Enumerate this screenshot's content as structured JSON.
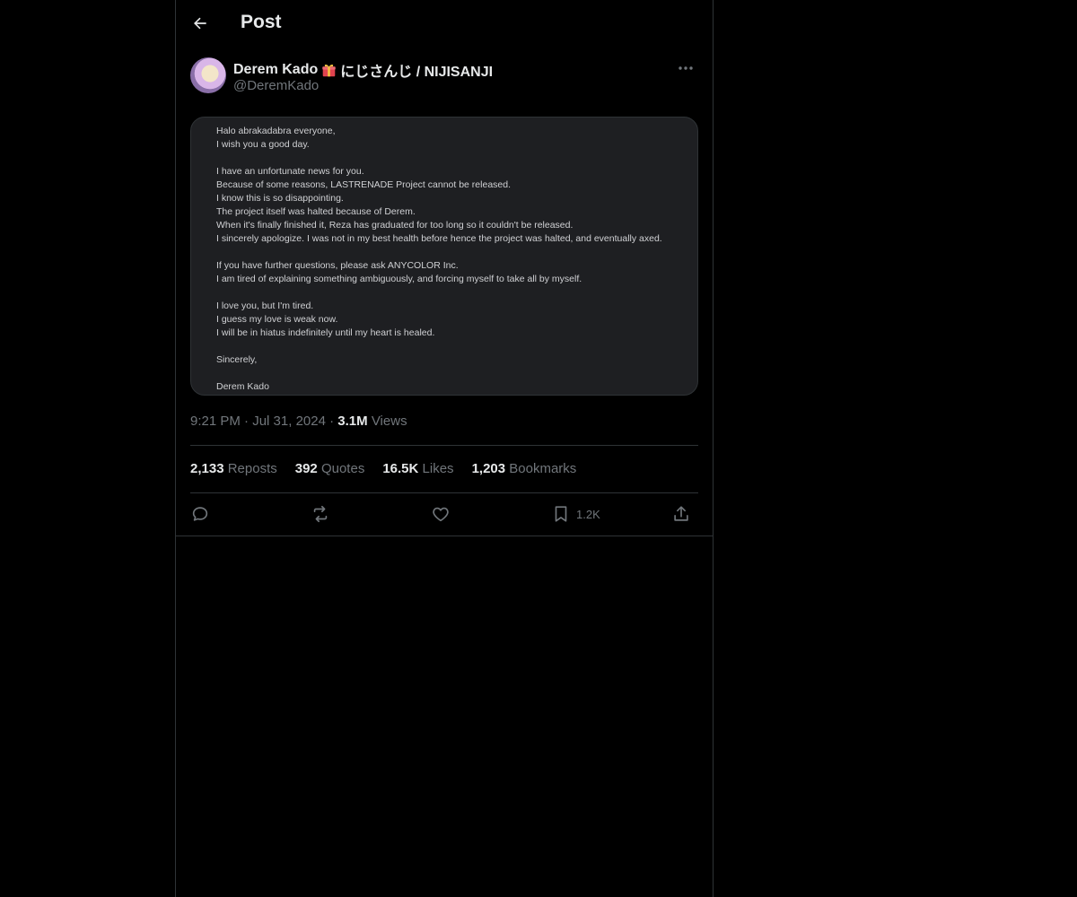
{
  "header": {
    "title": "Post"
  },
  "author": {
    "display_name": "Derem Kado",
    "display_name_suffix": "にじさんじ / NIJISANJI",
    "handle": "@DeremKado"
  },
  "media": {
    "lines": [
      "Halo abrakadabra everyone,",
      "I wish you a good day.",
      "",
      "I have an unfortunate news for you.",
      "Because of some reasons, LASTRENADE Project cannot be released.",
      "I know this is so disappointing.",
      "The project itself was halted because of Derem.",
      "When it's finally finished it, Reza has graduated for too long so it couldn't be released.",
      "I sincerely apologize. I was not in my best health before hence the project was halted, and eventually axed.",
      "",
      "If you have further questions, please ask ANYCOLOR Inc.",
      "I am tired of explaining something ambiguously, and forcing myself to take all by myself.",
      "",
      "I love you, but I'm tired.",
      "I guess my love is weak now.",
      "I will be in hiatus indefinitely until my heart is healed.",
      "",
      "Sincerely,",
      "",
      "Derem Kado"
    ]
  },
  "meta": {
    "time": "9:21 PM",
    "sep": "·",
    "date": "Jul 31, 2024",
    "views_count": "3.1M",
    "views_label": "Views"
  },
  "stats": {
    "reposts_count": "2,133",
    "reposts_label": "Reposts",
    "quotes_count": "392",
    "quotes_label": "Quotes",
    "likes_count": "16.5K",
    "likes_label": "Likes",
    "bookmarks_count": "1,203",
    "bookmarks_label": "Bookmarks"
  },
  "actions": {
    "bookmark_count": "1.2K",
    "icons": [
      "reply-icon",
      "repost-icon",
      "like-icon",
      "bookmark-icon",
      "share-icon"
    ]
  }
}
